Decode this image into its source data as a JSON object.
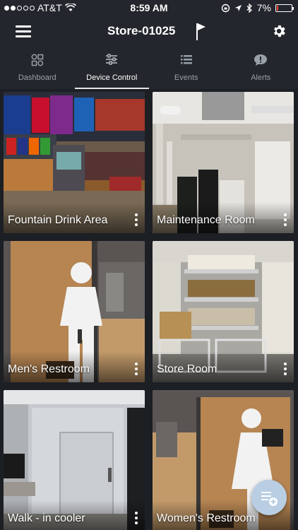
{
  "status_bar": {
    "carrier": "AT&T",
    "time": "8:59 AM",
    "battery": "7%",
    "battery_level": 0.07
  },
  "header": {
    "title": "Store-01025"
  },
  "tabs": [
    {
      "label": "Dashboard",
      "icon": "dashboard-icon",
      "active": false
    },
    {
      "label": "Device Control",
      "icon": "sliders-icon",
      "active": true
    },
    {
      "label": "Events",
      "icon": "list-icon",
      "active": false
    },
    {
      "label": "Alerts",
      "icon": "alert-bubble-icon",
      "active": false
    }
  ],
  "cards": [
    {
      "label": "Fountain Drink Area"
    },
    {
      "label": "Maintenance Room"
    },
    {
      "label": "Men's Restroom"
    },
    {
      "label": "Store Room"
    },
    {
      "label": "Walk - in cooler"
    },
    {
      "label": "Women's Restroom"
    }
  ],
  "colors": {
    "background": "#1c1f24",
    "bar": "#23262c",
    "fab": "#b9cee3",
    "inactive_text": "#9aa0a8"
  }
}
